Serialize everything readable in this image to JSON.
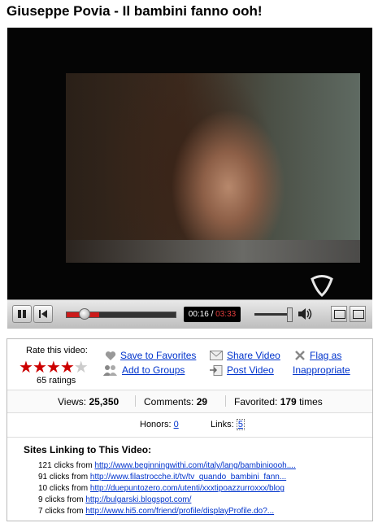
{
  "title": "Giuseppe Povia - Il bambini fanno ooh!",
  "player": {
    "current_time": "00:16",
    "separator": "/",
    "total_time": "03:33",
    "progress": 0.075,
    "volume": 0.95
  },
  "rating": {
    "label": "Rate this video:",
    "stars": 4,
    "max": 5,
    "count_text": "65 ratings"
  },
  "actions": {
    "save_favorites": "Save to Favorites",
    "add_groups": "Add to Groups",
    "share": "Share Video",
    "post": "Post Video",
    "flag_line1": "Flag as",
    "flag_line2": "Inappropriate"
  },
  "stats": {
    "views_label": "Views:",
    "views": "25,350",
    "comments_label": "Comments:",
    "comments": "29",
    "favorited_label": "Favorited:",
    "favorited": "179",
    "favorited_suffix": "times"
  },
  "honors": {
    "label": "Honors:",
    "value": "0"
  },
  "links": {
    "label": "Links:",
    "value": "5"
  },
  "sites": {
    "title": "Sites Linking to This Video:",
    "rows": [
      {
        "clicks": "121 clicks from",
        "url": "http://www.beginningwithi.com/italy/lang/bambinioooh...."
      },
      {
        "clicks": "91 clicks from",
        "url": "http://www.filastrocche.it/tv/tv_quando_bambini_fann..."
      },
      {
        "clicks": "10 clicks from",
        "url": "http://duepuntozero.com/utenti/xxxtipoazzurroxxx/blog"
      },
      {
        "clicks": "9 clicks from",
        "url": "http://bulgarski.blogspot.com/"
      },
      {
        "clicks": "7 clicks from",
        "url": "http://www.hi5.com/friend/profile/displayProfile.do?..."
      }
    ]
  },
  "colors": {
    "link": "#0033cc",
    "star": "#cc0000",
    "progress": "#cc1b1b"
  },
  "icons": [
    "heart-icon",
    "group-icon",
    "envelope-icon",
    "post-icon",
    "flag-x-icon"
  ]
}
